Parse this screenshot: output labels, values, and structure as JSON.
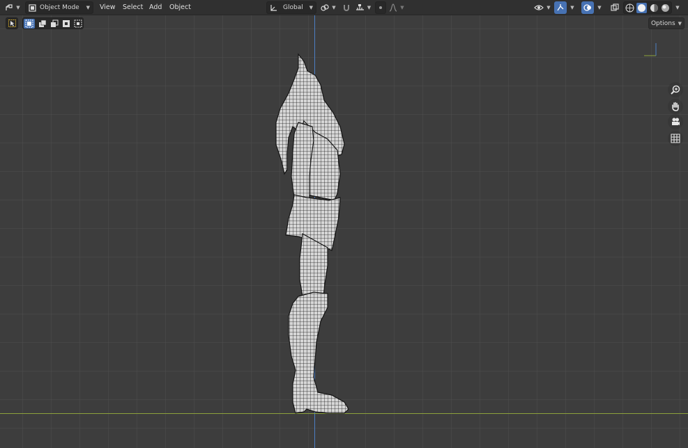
{
  "header": {
    "mode_label": "Object Mode",
    "menus": [
      "View",
      "Select",
      "Add",
      "Object"
    ],
    "orientation_label": "Global"
  },
  "toolbar": {
    "options_label": "Options"
  },
  "colors": {
    "accent": "#4772b3",
    "grid_bg": "#3d3d3d",
    "header_bg": "#303030",
    "x_axis": "#8da23c",
    "z_axis": "#4d7fc4"
  },
  "icons": {
    "editor_type": "viewport-editor-icon",
    "mode": "object-mode-icon",
    "transform_orientation": "transform-axes-icon",
    "pivot": "pivot-link-icon",
    "snap": "magnet-icon",
    "proportional": "proportional-edit-icon",
    "falloff": "falloff-curve-icon",
    "visibility": "eye-icon",
    "gizmo": "gizmo-icon",
    "overlay": "overlay-icon",
    "xray": "xray-icon",
    "shading": [
      "wireframe-shading-icon",
      "solid-shading-icon",
      "material-shading-icon",
      "rendered-shading-icon"
    ],
    "nav": [
      "zoom-icon",
      "pan-hand-icon",
      "camera-icon",
      "ortho-grid-icon"
    ]
  }
}
